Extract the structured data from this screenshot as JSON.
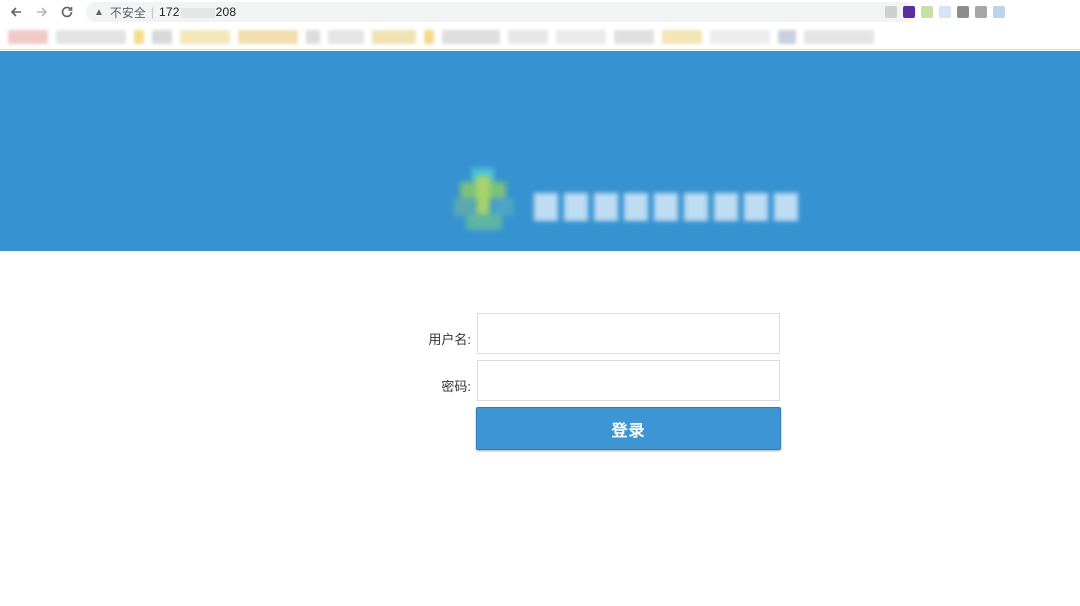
{
  "browser": {
    "back_icon": "arrow-left-icon",
    "forward_icon": "arrow-right-icon",
    "reload_icon": "reload-icon",
    "security_icon": "warning-triangle-icon",
    "security_label": "不安全",
    "url_prefix": "172",
    "url_suffix": "208"
  },
  "banner": {
    "background_color": "#3692d1",
    "logo_icon": "system-logo-icon"
  },
  "login": {
    "username_label": "用户名:",
    "username_value": "",
    "password_label": "密码:",
    "password_value": "",
    "submit_label": "登录",
    "accent_color": "#3d96d3"
  }
}
